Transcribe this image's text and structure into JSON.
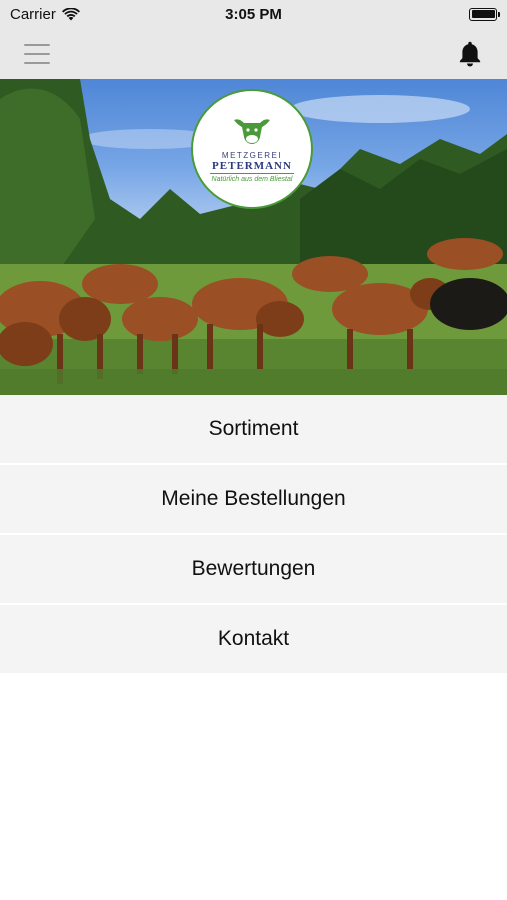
{
  "status_bar": {
    "carrier": "Carrier",
    "time": "3:05 PM"
  },
  "nav": {
    "menu_icon": "hamburger-icon",
    "notification_icon": "bell-icon"
  },
  "logo": {
    "top_text": "METZGEREI",
    "brand": "PETERMANN",
    "tagline": "Natürlich aus dem Bliestal"
  },
  "menu": {
    "items": [
      {
        "label": "Sortiment"
      },
      {
        "label": "Meine Bestellungen"
      },
      {
        "label": "Bewertungen"
      },
      {
        "label": "Kontakt"
      }
    ]
  },
  "colors": {
    "bar_background": "#e8e8e8",
    "menu_background": "#f4f4f4",
    "logo_green": "#4b9a3a",
    "logo_blue": "#2b3a7f"
  }
}
